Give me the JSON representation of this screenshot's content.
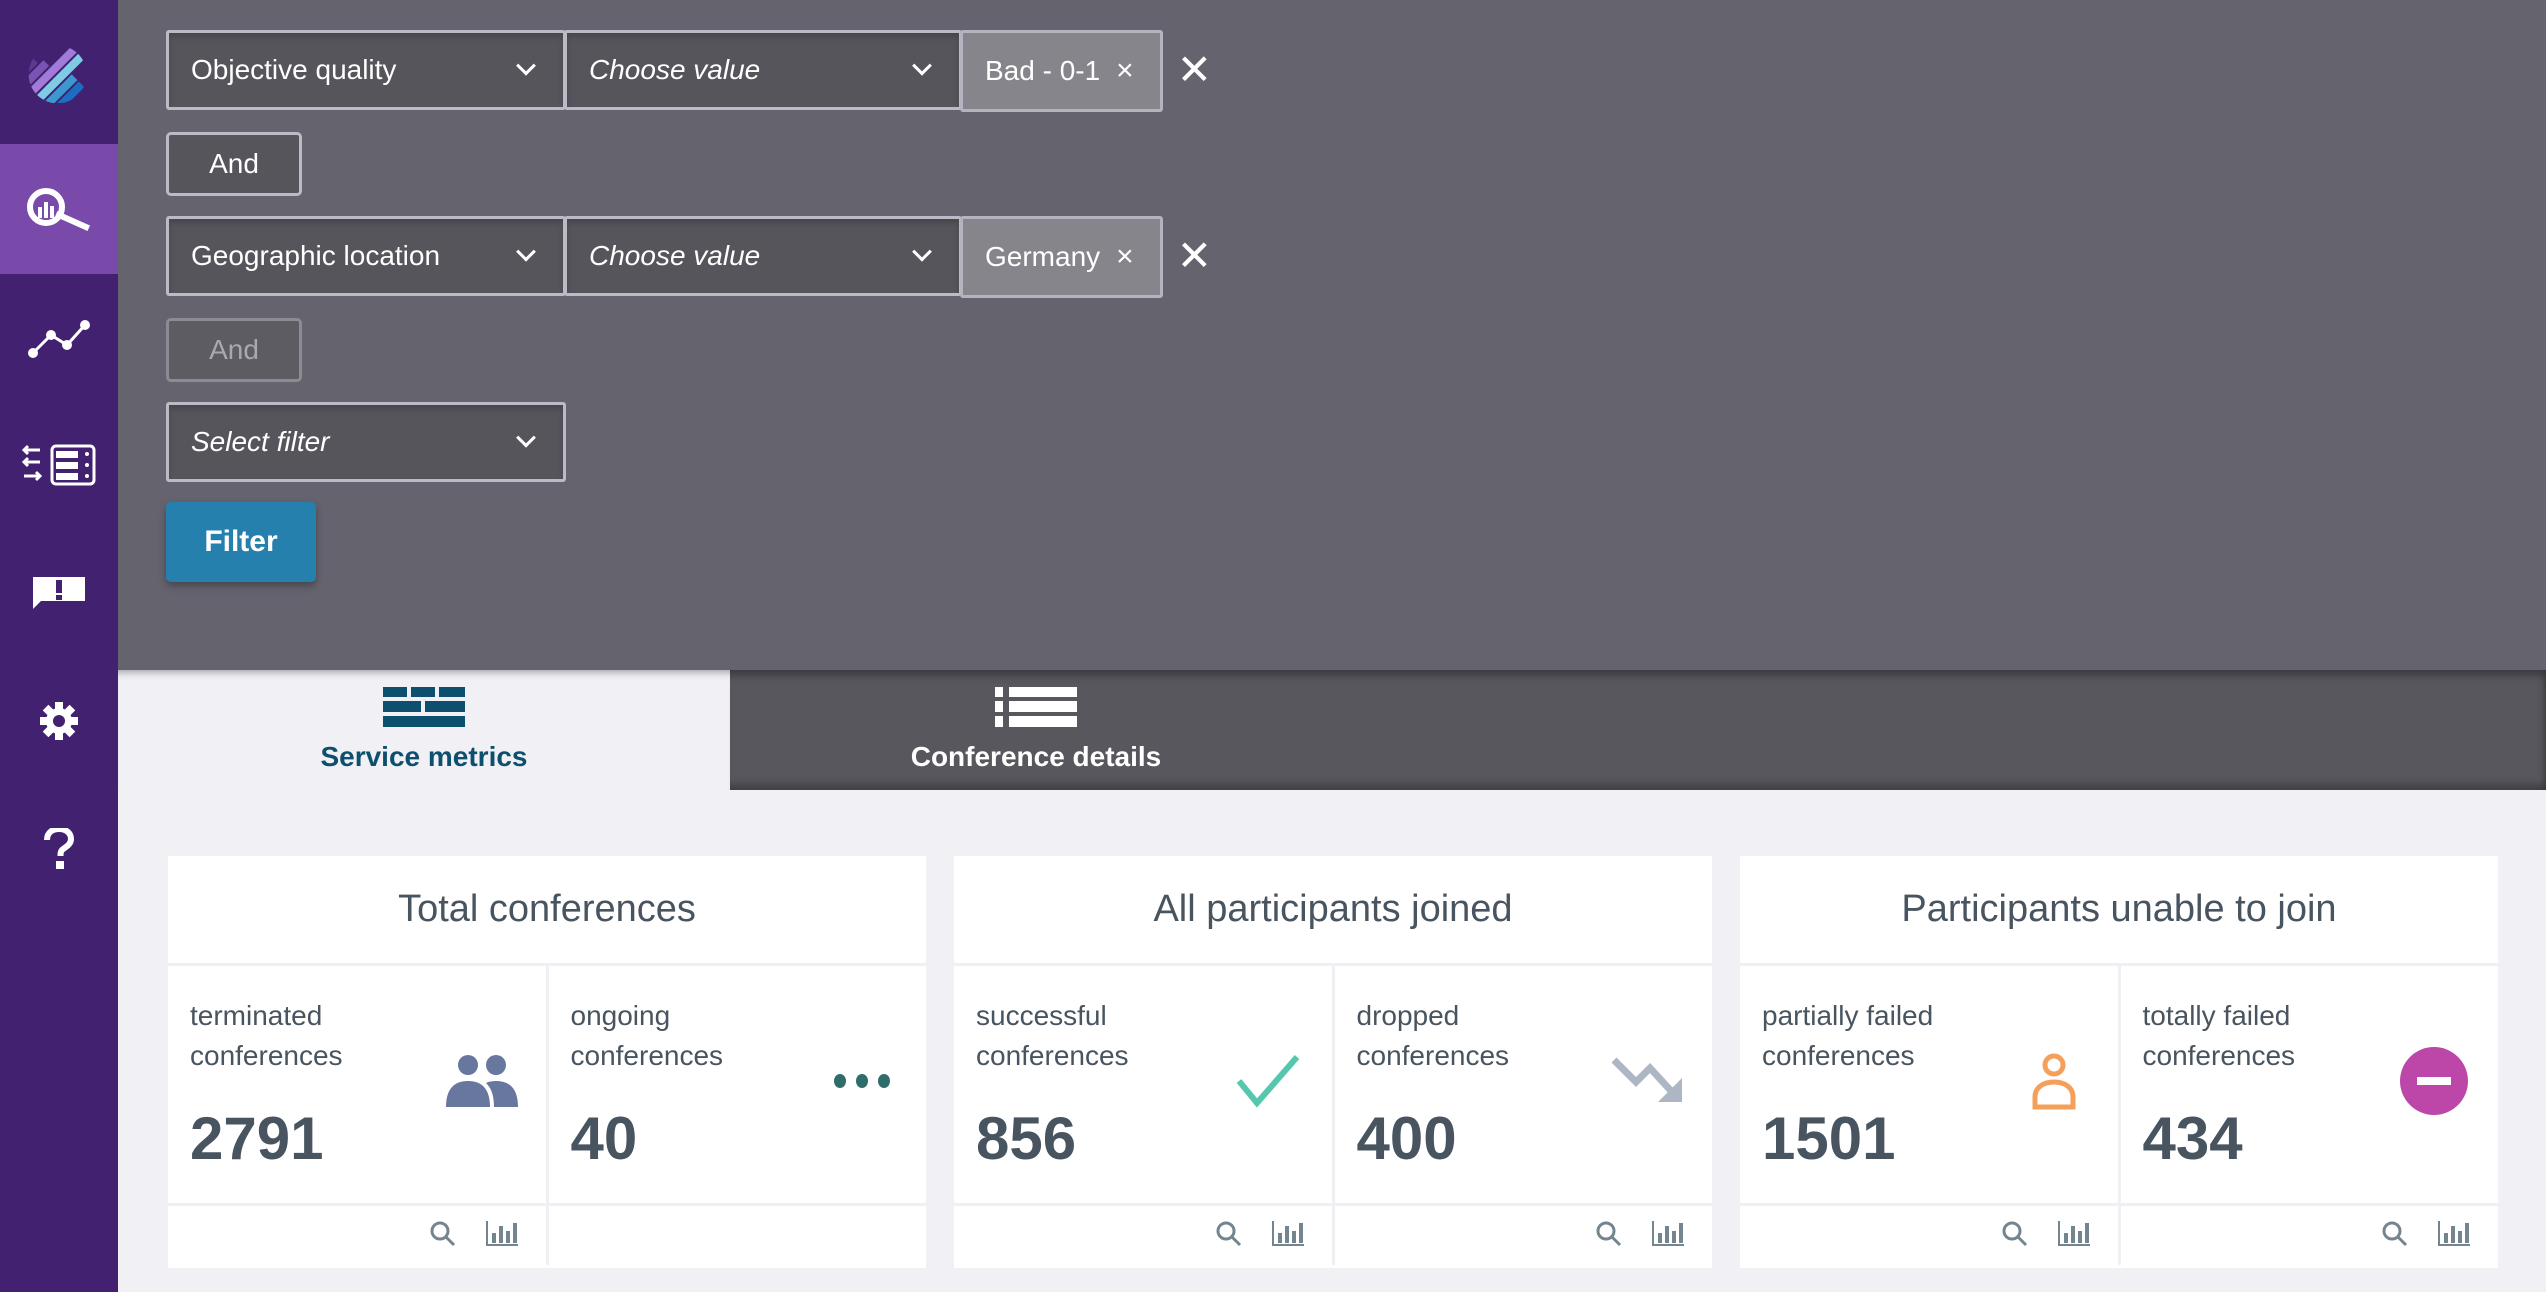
{
  "sidebar": {
    "logo": "app-logo",
    "items": [
      {
        "name": "analytics-search",
        "icon": "chart-search-icon",
        "active": true
      },
      {
        "name": "trends",
        "icon": "line-chart-icon",
        "active": false
      },
      {
        "name": "servers",
        "icon": "server-list-icon",
        "active": false
      },
      {
        "name": "alerts",
        "icon": "alert-message-icon",
        "active": false
      },
      {
        "name": "settings",
        "icon": "gear-icon",
        "active": false
      },
      {
        "name": "help",
        "icon": "question-icon",
        "active": false
      }
    ]
  },
  "filters": {
    "rows": [
      {
        "field": "Objective quality",
        "value_placeholder": "Choose value",
        "tag": "Bad - 0-1"
      },
      {
        "field": "Geographic location",
        "value_placeholder": "Choose value",
        "tag": "Germany"
      }
    ],
    "and_label": "And",
    "and_disabled_label": "And",
    "select_filter_placeholder": "Select filter",
    "filter_button": "Filter",
    "tag_remove_glyph": "×",
    "row_remove_glyph": "✕"
  },
  "tabs": [
    {
      "label": "Service metrics",
      "icon": "grid-icon",
      "active": true
    },
    {
      "label": "Conference details",
      "icon": "list-icon",
      "active": false
    }
  ],
  "cards": [
    {
      "title": "Total conferences",
      "metrics": [
        {
          "label": "terminated conferences",
          "value": "2791",
          "icon": "people-icon",
          "color": "#68779d",
          "actions": true
        },
        {
          "label": "ongoing conferences",
          "value": "40",
          "icon": "more-dots-icon",
          "color": "#2e6d6a",
          "actions": false
        }
      ]
    },
    {
      "title": "All participants joined",
      "metrics": [
        {
          "label": "successful conferences",
          "value": "856",
          "icon": "checkmark-icon",
          "color": "#55c7ad",
          "actions": true
        },
        {
          "label": "dropped conferences",
          "value": "400",
          "icon": "trend-down-icon",
          "color": "#adb6c3",
          "actions": true
        }
      ]
    },
    {
      "title": "Participants unable to join",
      "metrics": [
        {
          "label": "partially failed conferences",
          "value": "1501",
          "icon": "person-outline-icon",
          "color": "#f5a05a",
          "actions": true
        },
        {
          "label": "totally failed conferences",
          "value": "434",
          "icon": "minus-circle-icon",
          "color": "#bc47a8",
          "actions": true
        }
      ]
    }
  ],
  "colors": {
    "sidebar_bg": "#422171",
    "sidebar_active": "#7a4aab",
    "filter_panel_bg": "#65636e",
    "filter_button": "#2580ad",
    "tab_active_text": "#0c4f6e",
    "text_dark": "#48545f"
  }
}
